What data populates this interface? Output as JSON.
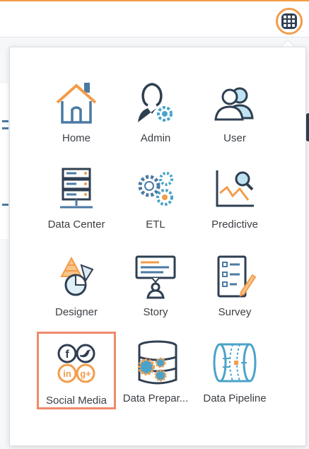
{
  "header": {
    "apps_icon": "apps-grid-icon",
    "accent_color": "#f39c4a"
  },
  "menu": {
    "selected_item": "Social Media",
    "highlight_color": "#ef8a6a",
    "items": [
      {
        "label": "Home",
        "icon": "home-icon"
      },
      {
        "label": "Admin",
        "icon": "admin-icon"
      },
      {
        "label": "User",
        "icon": "user-icon"
      },
      {
        "label": "Data Center",
        "icon": "data-center-icon"
      },
      {
        "label": "ETL",
        "icon": "etl-icon"
      },
      {
        "label": "Predictive",
        "icon": "predictive-icon"
      },
      {
        "label": "Designer",
        "icon": "designer-icon"
      },
      {
        "label": "Story",
        "icon": "story-icon"
      },
      {
        "label": "Survey",
        "icon": "survey-icon"
      },
      {
        "label": "Social Media",
        "icon": "social-media-icon"
      },
      {
        "label": "Data Prepar...",
        "icon": "data-preparation-icon"
      },
      {
        "label": "Data Pipeline",
        "icon": "data-pipeline-icon"
      }
    ]
  },
  "social_icons": {
    "facebook": "f",
    "twitter": "t",
    "linkedin": "in",
    "googleplus": "g+"
  }
}
